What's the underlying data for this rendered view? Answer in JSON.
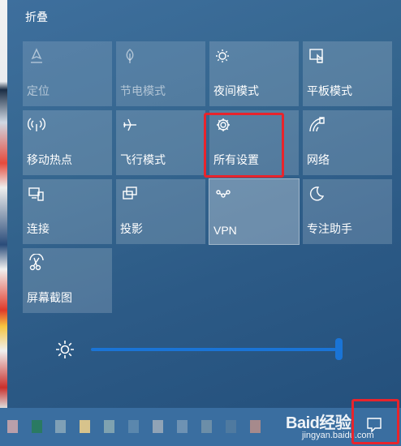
{
  "header": {
    "collapse_label": "折叠"
  },
  "tiles": [
    {
      "label": "定位",
      "icon": "location-icon",
      "state": "disabled"
    },
    {
      "label": "节电模式",
      "icon": "battery-saver-icon",
      "state": "disabled"
    },
    {
      "label": "夜间模式",
      "icon": "night-light-icon",
      "state": "normal"
    },
    {
      "label": "平板模式",
      "icon": "tablet-mode-icon",
      "state": "normal"
    },
    {
      "label": "移动热点",
      "icon": "mobile-hotspot-icon",
      "state": "normal"
    },
    {
      "label": "飞行模式",
      "icon": "airplane-icon",
      "state": "normal"
    },
    {
      "label": "所有设置",
      "icon": "gear-icon",
      "state": "normal",
      "highlighted": true
    },
    {
      "label": "网络",
      "icon": "network-icon",
      "state": "normal"
    },
    {
      "label": "连接",
      "icon": "connect-icon",
      "state": "normal"
    },
    {
      "label": "投影",
      "icon": "project-icon",
      "state": "normal"
    },
    {
      "label": "VPN",
      "icon": "vpn-icon",
      "state": "active"
    },
    {
      "label": "专注助手",
      "icon": "focus-assist-icon",
      "state": "normal"
    },
    {
      "label": "屏幕截图",
      "icon": "screen-snip-icon",
      "state": "normal"
    }
  ],
  "brightness": {
    "icon": "brightness-icon",
    "level_percent": 100,
    "color": "#1a74d6"
  },
  "taskbar": {
    "notification_icon": "action-center-icon",
    "highlighted": true,
    "watermark": {
      "main": "Baid经验",
      "sub": "jingyan.baidu.com"
    }
  },
  "colors": {
    "highlight": "#e8242c",
    "accent": "#1a74d6"
  }
}
